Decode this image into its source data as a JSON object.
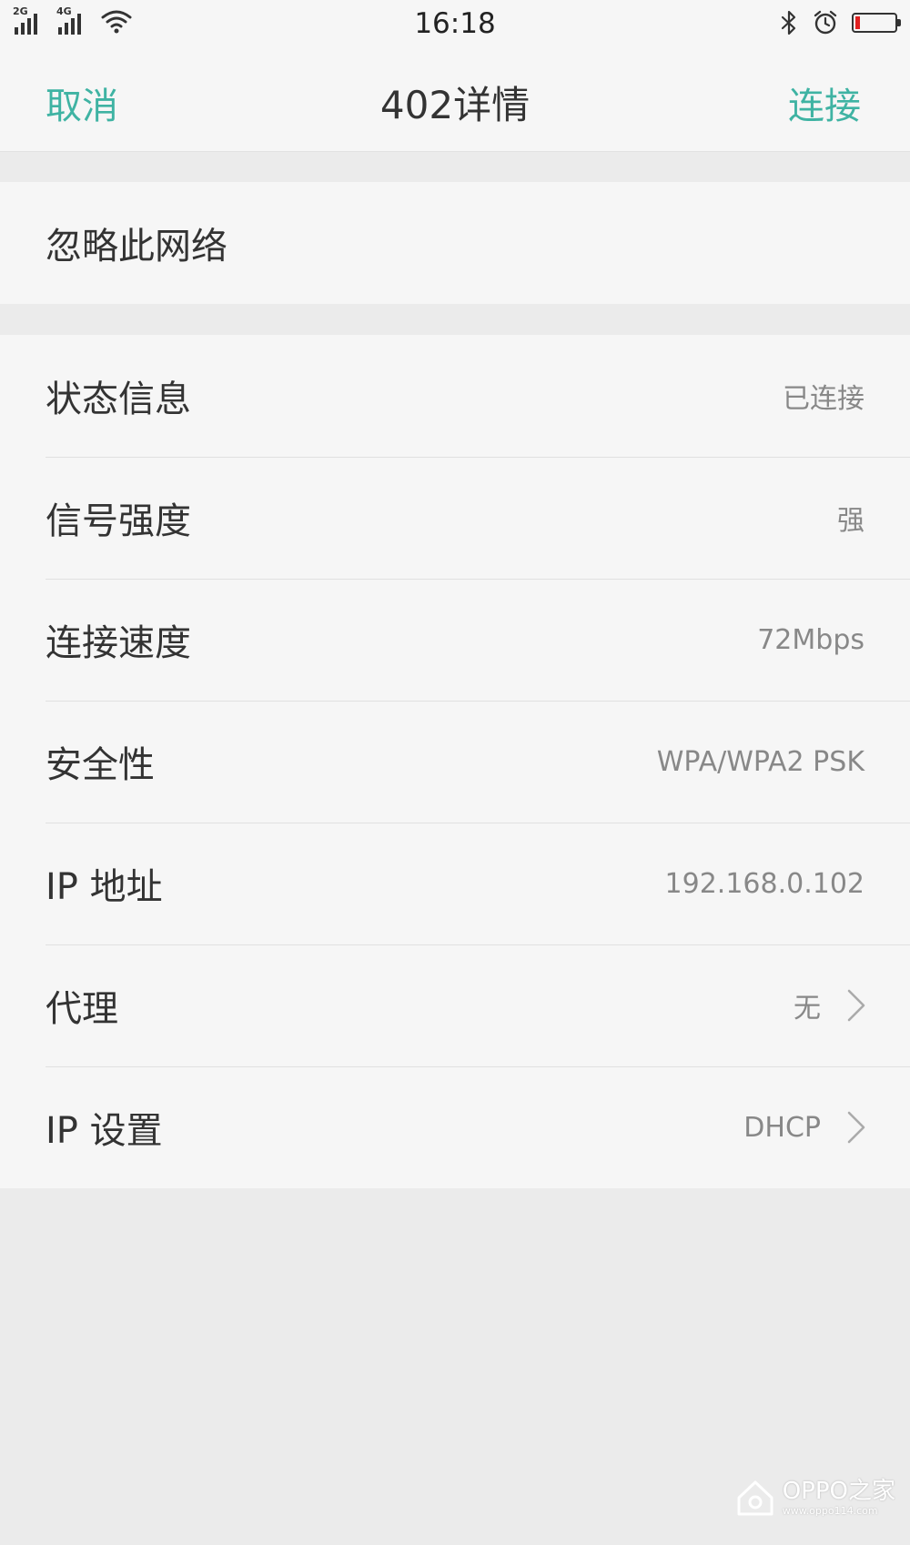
{
  "status_bar": {
    "sim1_label": "2G",
    "sim2_label": "4G",
    "time": "16:18",
    "icons": [
      "signal-icon",
      "signal-icon",
      "wifi-icon",
      "bluetooth-icon",
      "alarm-icon",
      "battery-icon"
    ],
    "battery_level": 0.12,
    "battery_color": "#e02020"
  },
  "nav": {
    "cancel_label": "取消",
    "title": "402详情",
    "connect_label": "连接",
    "accent_color": "#3fb3a3"
  },
  "forget": {
    "label": "忽略此网络"
  },
  "details": {
    "rows": [
      {
        "label": "状态信息",
        "value": "已连接"
      },
      {
        "label": "信号强度",
        "value": "强"
      },
      {
        "label": "连接速度",
        "value": "72Mbps"
      },
      {
        "label": "安全性",
        "value": "WPA/WPA2 PSK"
      },
      {
        "label": "IP 地址",
        "value": "192.168.0.102"
      },
      {
        "label": "代理",
        "value": "无",
        "icon": "chevron-right-icon"
      },
      {
        "label": "IP 设置",
        "value": "DHCP",
        "icon": "chevron-right-icon"
      }
    ]
  },
  "watermark": {
    "brand": "OPPO之家",
    "url": "www.oppo114.com",
    "icon": "oppo-home-logo-icon"
  }
}
